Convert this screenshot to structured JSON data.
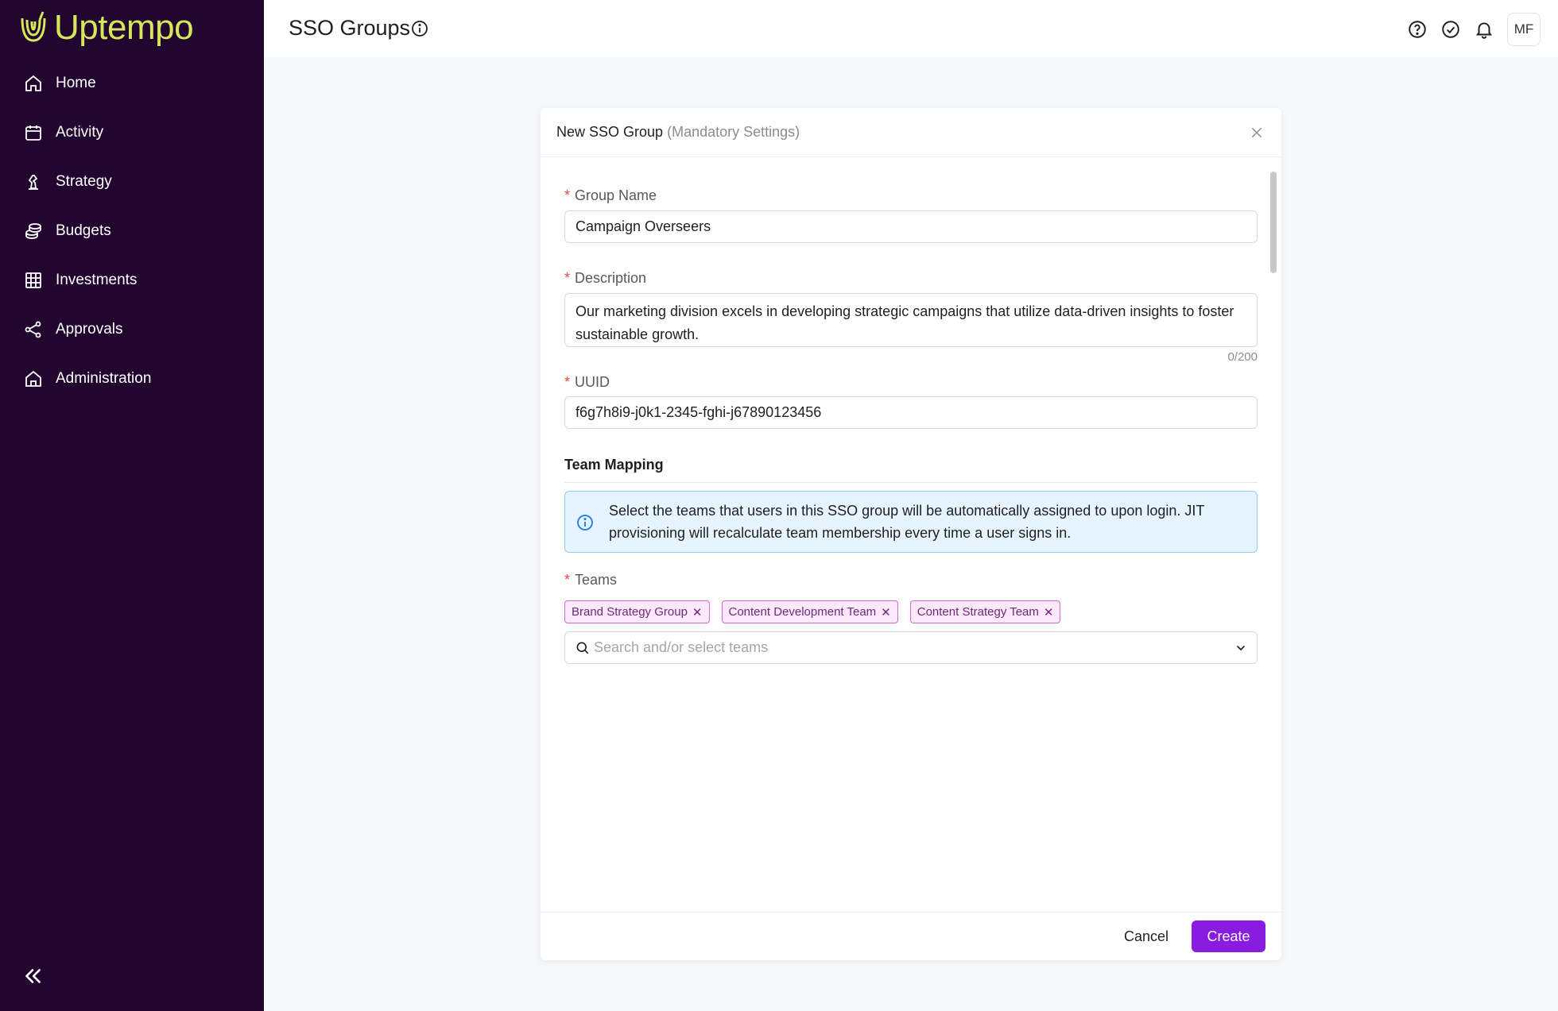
{
  "app": {
    "name": "Uptempo",
    "brand_color": "#d4e85a",
    "sidebar_color": "#22062f",
    "accent_color": "#8a1be0"
  },
  "sidebar": {
    "items": [
      {
        "label": "Home",
        "icon": "home-icon"
      },
      {
        "label": "Activity",
        "icon": "calendar-icon"
      },
      {
        "label": "Strategy",
        "icon": "chess-piece-icon"
      },
      {
        "label": "Budgets",
        "icon": "coins-icon"
      },
      {
        "label": "Investments",
        "icon": "grid-table-icon"
      },
      {
        "label": "Approvals",
        "icon": "share-nodes-icon"
      },
      {
        "label": "Administration",
        "icon": "building-icon"
      }
    ],
    "collapse_icon": "double-chevron-left-icon"
  },
  "header": {
    "title": "SSO Groups",
    "avatar_initials": "MF"
  },
  "modal": {
    "title": "New SSO Group",
    "subtitle": "(Mandatory Settings)",
    "group_name": {
      "label": "Group Name",
      "value": "Campaign Overseers"
    },
    "description": {
      "label": "Description",
      "value": "Our marketing division excels in developing strategic campaigns that utilize data-driven insights to foster sustainable growth.",
      "counter": "0/200"
    },
    "uuid": {
      "label": "UUID",
      "value": "f6g7h8i9-j0k1-2345-fghi-j67890123456"
    },
    "team_mapping": {
      "title": "Team Mapping",
      "info": "Select the teams that users in this SSO group will be automatically assigned to upon login. JIT provisioning will recalculate team membership every time a user signs in."
    },
    "teams": {
      "label": "Teams",
      "tags": [
        "Brand Strategy Group",
        "Content Development Team",
        "Content Strategy Team"
      ],
      "placeholder": "Search and/or select teams"
    },
    "footer": {
      "cancel": "Cancel",
      "create": "Create"
    }
  }
}
